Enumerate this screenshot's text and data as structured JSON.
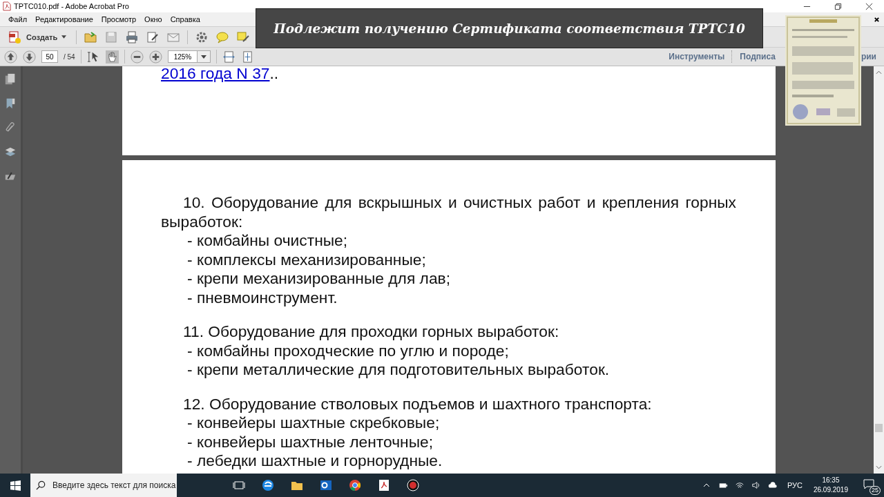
{
  "window": {
    "title": "TPTC010.pdf - Adobe Acrobat Pro"
  },
  "menu": [
    "Файл",
    "Редактирование",
    "Просмотр",
    "Окно",
    "Справка"
  ],
  "toolbar": {
    "create_button": "Создать"
  },
  "navigation": {
    "page_number": "50",
    "page_total": "/ 54",
    "zoom": "125%"
  },
  "panes": [
    {
      "label": "Инструменты"
    },
    {
      "label": "Подписа"
    },
    {
      "label": "рии"
    }
  ],
  "overlay": {
    "banner": "Подлежит получению Сертификата соответствия ТРТС10"
  },
  "document": {
    "previous_page": {
      "link": "2016 года N 37",
      "after_link": ".."
    },
    "sections": [
      {
        "heading": "10. Оборудование для вскрышных и очистных работ и крепления горных выработок:",
        "items": [
          "- комбайны очистные;",
          "- комплексы механизированные;",
          "- крепи механизированные для лав;",
          "- пневмоинструмент."
        ]
      },
      {
        "heading": "11. Оборудование для проходки горных выработок:",
        "items": [
          "- комбайны проходческие по углю и породе;",
          "- крепи металлические для подготовительных выработок."
        ]
      },
      {
        "heading": "12. Оборудование стволовых подъемов и шахтного транспорта:",
        "items": [
          "- конвейеры шахтные скребковые;",
          "- конвейеры шахтные ленточные;",
          "- лебедки шахтные и горнорудные."
        ]
      }
    ]
  },
  "taskbar": {
    "search_placeholder": "Введите здесь текст для поиска",
    "language": "РУС",
    "time": "16:35",
    "date": "26.09.2019",
    "notifications": "25"
  }
}
